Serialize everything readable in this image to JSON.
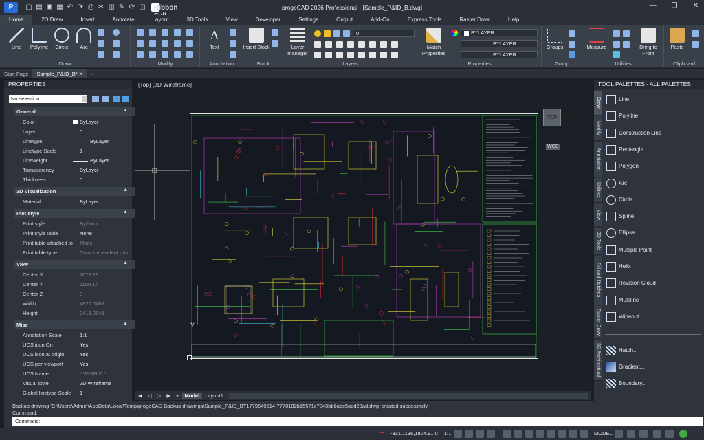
{
  "app": {
    "title": "progeCAD 2026 Professional - [Sample_P&ID_B.dwg]",
    "ribbon_mode": "Ribbon Full",
    "logo_letter": "P"
  },
  "menu_tabs": [
    "Home",
    "2D Draw",
    "Insert",
    "Annotate",
    "Layout",
    "3D Tools",
    "View",
    "Developer",
    "Settings",
    "Output",
    "Add-On",
    "Express Tools",
    "Raster Draw",
    "Help"
  ],
  "ribbon": {
    "draw": {
      "label": "Draw",
      "tools": [
        "Line",
        "Polyline",
        "Circle",
        "Arc"
      ]
    },
    "modify": {
      "label": "Modify"
    },
    "annotation": {
      "label": "Annotation",
      "text": "Text",
      "dimension": "Dimension"
    },
    "block": {
      "label": "Block",
      "insert": "Insert Block"
    },
    "layers": {
      "label": "Layers",
      "manager": "Layer manager",
      "current": "0"
    },
    "properties": {
      "label": "Properties",
      "match": "Match Properties",
      "color": "BYLAYER",
      "linetype": "BYLAYER",
      "lineweight": "BYLAYER"
    },
    "group": {
      "label": "Group",
      "groups": "Groups"
    },
    "utilities": {
      "label": "Utilities",
      "measure": "Measure",
      "bring": "Bring to Front"
    },
    "clipboard": {
      "label": "Clipboard",
      "paste": "Paste"
    }
  },
  "doc_tabs": {
    "start": "Start Page",
    "active": "Sample_P&ID_B*",
    "add": "+"
  },
  "properties": {
    "title": "PROPERTIES",
    "selection": "No selection",
    "sections": [
      {
        "name": "General",
        "rows": [
          [
            "Color",
            "ByLayer"
          ],
          [
            "Layer",
            "0"
          ],
          [
            "Linetype",
            "ByLayer"
          ],
          [
            "Linetype Scale",
            "1"
          ],
          [
            "Lineweight",
            "ByLayer"
          ],
          [
            "Transparency",
            "ByLayer"
          ],
          [
            "Thickness",
            "0"
          ]
        ]
      },
      {
        "name": "3D Visualization",
        "rows": [
          [
            "Material",
            "ByLayer"
          ]
        ]
      },
      {
        "name": "Plot style",
        "rows": [
          [
            "Print style",
            "ByColor"
          ],
          [
            "Print style table",
            "None"
          ],
          [
            "Print table attached to",
            "Model"
          ],
          [
            "Print table type",
            "Color-dependent prin..."
          ]
        ]
      },
      {
        "name": "View",
        "rows": [
          [
            "Center X",
            "1672.29"
          ],
          [
            "Center Y",
            "1180.17"
          ],
          [
            "Center Z",
            "0"
          ],
          [
            "Width",
            "4820.0466"
          ],
          [
            "Height",
            "2413.0548"
          ]
        ]
      },
      {
        "name": "Misc",
        "rows": [
          [
            "Annotation Scale",
            "1:1"
          ],
          [
            "UCS icon On",
            "Yes"
          ],
          [
            "UCS icon at origin",
            "Yes"
          ],
          [
            "UCS per viewport",
            "Yes"
          ],
          [
            "UCS Name",
            "* WORLD *"
          ],
          [
            "Visual style",
            "2D Wireframe"
          ],
          [
            "Global linetype Scale",
            "1"
          ]
        ]
      }
    ]
  },
  "viewport": {
    "label": "[Top] [2D Wireframe]",
    "cube": "TOP",
    "wcs": "WCS",
    "y_axis": "Y"
  },
  "layout_tabs": {
    "model": "Model",
    "layout1": "Layout1"
  },
  "palettes": {
    "title": "TOOL PALETTES - ALL PALETTES",
    "side_tabs": [
      "Draw",
      "Modify",
      "Annotation",
      "Utilities",
      "View",
      "3D Tools",
      "Fill and Hatches",
      "Raster Draw",
      "3D Architectural"
    ],
    "tools": [
      "Line",
      "Polyline",
      "Construction Line",
      "Rectangle",
      "Polygon",
      "Arc",
      "Circle",
      "Spline",
      "Ellipse",
      "Multiple Point",
      "Helix",
      "Revision Cloud",
      "Multiline",
      "Wipeout"
    ],
    "hatch_tools": [
      "Hatch...",
      "Gradient...",
      "Boundary..."
    ]
  },
  "command": {
    "history1": "Backup drawing 'C:\\Users\\Admin\\AppData\\Local\\Temp\\progeCAD Backup drawings\\Sample_P&ID_BT1779649514-7770182b15571c7843bb6adc5add23ad.dwg' created successfully",
    "history2": "Command:",
    "prompt": "Command:"
  },
  "status": {
    "coords": "-331.1136,1804.91,0",
    "scale": "1:1",
    "model": "MODEL"
  },
  "colors": {
    "accent": "#2a6bd6",
    "drawing_red": "#e03030",
    "drawing_green": "#3fd24a",
    "drawing_yellow": "#e8e23a",
    "drawing_magenta": "#c040c0",
    "drawing_cyan": "#40c8d8"
  }
}
